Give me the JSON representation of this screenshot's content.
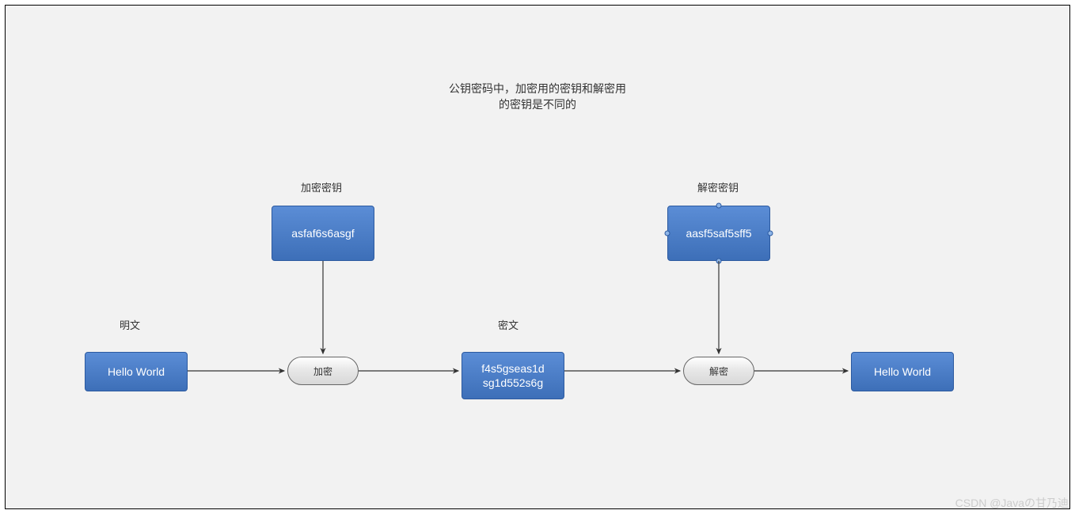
{
  "title_line1": "公钥密码中，加密用的密钥和解密用",
  "title_line2": "的密钥是不同的",
  "labels": {
    "plaintext": "明文",
    "ciphertext": "密文",
    "encrypt_key": "加密密钥",
    "decrypt_key": "解密密钥"
  },
  "nodes": {
    "plaintext_in": "Hello World",
    "encrypt_key_val": "asfaf6s6asgf",
    "encrypt_proc": "加密",
    "ciphertext_line1": "f4s5gseas1d",
    "ciphertext_line2": "sg1d552s6g",
    "decrypt_key_val": "aasf5saf5sff5",
    "decrypt_proc": "解密",
    "plaintext_out": "Hello World"
  },
  "watermark": "CSDN @Javaの甘乃迪"
}
